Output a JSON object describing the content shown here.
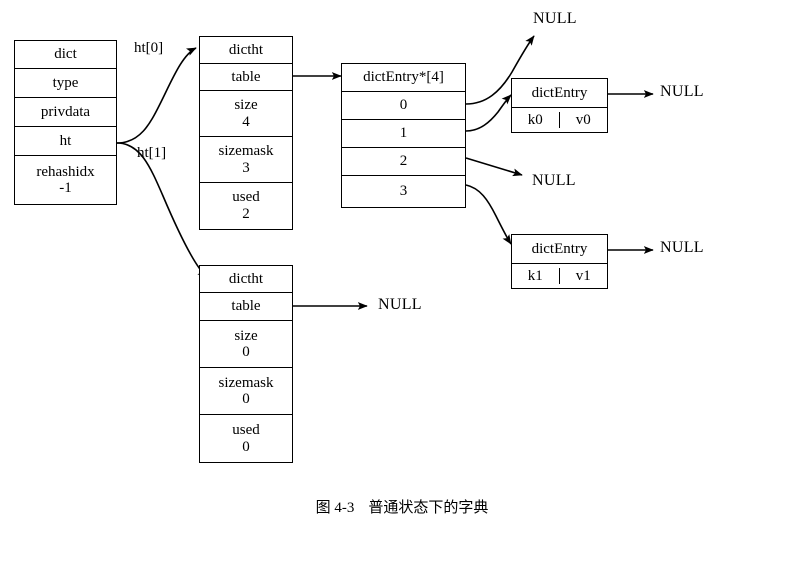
{
  "diagram": {
    "caption_number": "图 4-3",
    "caption_text": "普通状态下的字典",
    "stroke_color": "#000000",
    "background_color": "#ffffff"
  },
  "dict_struct": {
    "title": "dict",
    "fields": [
      {
        "name": "type",
        "value": ""
      },
      {
        "name": "privdata",
        "value": ""
      },
      {
        "name": "ht",
        "value": ""
      },
      {
        "name": "rehashidx",
        "value": "-1"
      }
    ]
  },
  "pointer_labels": {
    "ht0": "ht[0]",
    "ht1": "ht[1]"
  },
  "dictht0": {
    "title": "dictht",
    "fields": [
      {
        "name": "table",
        "value": ""
      },
      {
        "name": "size",
        "value": "4"
      },
      {
        "name": "sizemask",
        "value": "3"
      },
      {
        "name": "used",
        "value": "2"
      }
    ]
  },
  "dictht1": {
    "title": "dictht",
    "fields": [
      {
        "name": "table",
        "value": ""
      },
      {
        "name": "size",
        "value": "0"
      },
      {
        "name": "sizemask",
        "value": "0"
      },
      {
        "name": "used",
        "value": "0"
      }
    ]
  },
  "bucket_array": {
    "title": "dictEntry*[4]",
    "indexes": [
      "0",
      "1",
      "2",
      "3"
    ]
  },
  "entry0": {
    "title": "dictEntry",
    "key": "k0",
    "value": "v0"
  },
  "entry1": {
    "title": "dictEntry",
    "key": "k1",
    "value": "v1"
  },
  "null_labels": {
    "bucket0": "NULL",
    "bucket2": "NULL",
    "entry0_next": "NULL",
    "entry1_next": "NULL",
    "dictht1_table": "NULL"
  }
}
